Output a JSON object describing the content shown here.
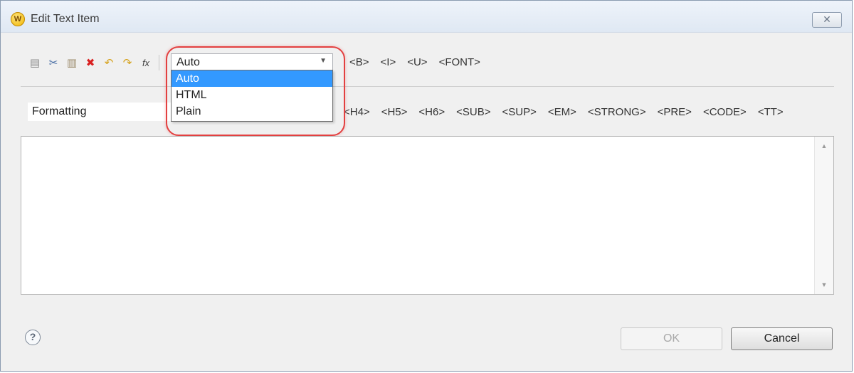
{
  "window": {
    "title": "Edit Text Item",
    "app_icon_letter": "W",
    "close_glyph": "✕"
  },
  "toolbar": {
    "icons": [
      {
        "name": "copy-icon",
        "glyph": "▤",
        "color": "#8a8a8a"
      },
      {
        "name": "cut-icon",
        "glyph": "✂",
        "color": "#4a6fa5"
      },
      {
        "name": "paste-icon",
        "glyph": "▥",
        "color": "#9a8a6a"
      },
      {
        "name": "delete-icon",
        "glyph": "✖",
        "color": "#d92020"
      },
      {
        "name": "undo-icon",
        "glyph": "↶",
        "color": "#d6a21c"
      },
      {
        "name": "redo-icon",
        "glyph": "↷",
        "color": "#d6a21c"
      },
      {
        "name": "function-icon",
        "glyph": "fx",
        "color": "#444444"
      }
    ],
    "content_type": {
      "value": "Auto",
      "options": [
        "Auto",
        "HTML",
        "Plain"
      ],
      "selected_index": 0
    },
    "tags_row1": [
      "<B>",
      "<I>",
      "<U>",
      "<FONT>"
    ]
  },
  "formatting": {
    "value": "Formatting"
  },
  "tags_row2": [
    "<H4>",
    "<H5>",
    "<H6>",
    "<SUB>",
    "<SUP>",
    "<EM>",
    "<STRONG>",
    "<PRE>",
    "<CODE>",
    "<TT>"
  ],
  "editor": {
    "text": "",
    "scroll_up_glyph": "▲",
    "scroll_down_glyph": "▼"
  },
  "footer": {
    "help_glyph": "?",
    "ok_label": "OK",
    "ok_enabled": false,
    "cancel_label": "Cancel"
  },
  "colors": {
    "selection": "#3399ff",
    "highlight_ring": "#e34040"
  }
}
